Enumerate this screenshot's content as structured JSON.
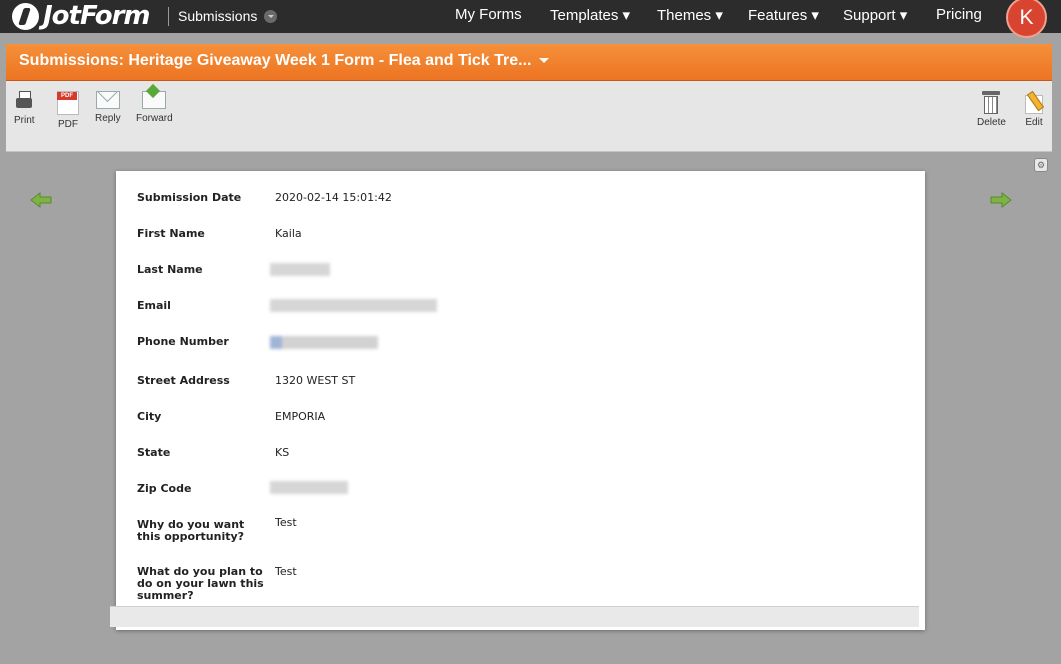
{
  "nav": {
    "logo_text": "JotForm",
    "section_label": "Submissions",
    "links": [
      "My Forms",
      "Templates ▾",
      "Themes ▾",
      "Features ▾",
      "Support ▾",
      "Pricing"
    ],
    "avatar_initial": "K",
    "avatar_color": "#d84430"
  },
  "panel": {
    "title": "Submissions: Heritage Giveaway Week 1 Form - Flea and Tick Tre...",
    "title_bar_color": "#ef7b2a"
  },
  "toolbar": {
    "print": "Print",
    "pdf": "PDF",
    "reply": "Reply",
    "forward": "Forward",
    "delete": "Delete",
    "edit": "Edit"
  },
  "submission": {
    "fields": [
      {
        "label": "Submission Date",
        "value": "2020-02-14 15:01:42"
      },
      {
        "label": "First Name",
        "value": "Kaila"
      },
      {
        "label": "Last Name",
        "value": ""
      },
      {
        "label": "Email",
        "value": ""
      },
      {
        "label": "Phone Number",
        "value": ""
      },
      {
        "label": "Street Address",
        "value": "1320 WEST ST"
      },
      {
        "label": "City",
        "value": "EMPORIA"
      },
      {
        "label": "State",
        "value": "KS"
      },
      {
        "label": "Zip Code",
        "value": ""
      },
      {
        "label": "Why do you want this opportunity?",
        "value": "Test"
      },
      {
        "label": "What do you plan to do on your lawn this summer?",
        "value": "Test"
      }
    ]
  }
}
